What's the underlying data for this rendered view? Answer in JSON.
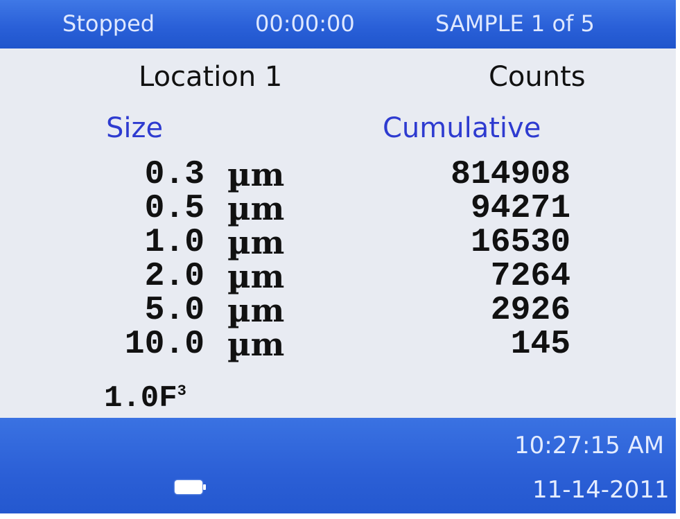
{
  "status_bar": {
    "status": "Stopped",
    "timer": "00:00:00",
    "sample": "SAMPLE 1 of 5"
  },
  "header": {
    "location": "Location 1",
    "counts": "Counts"
  },
  "columns": {
    "size": "Size",
    "cumulative": "Cumulative"
  },
  "rows": [
    {
      "size": "0.3",
      "unit": "µm",
      "count": "814908"
    },
    {
      "size": "0.5",
      "unit": "µm",
      "count": "94271"
    },
    {
      "size": "1.0",
      "unit": "µm",
      "count": "16530"
    },
    {
      "size": "2.0",
      "unit": "µm",
      "count": "7264"
    },
    {
      "size": "5.0",
      "unit": "µm",
      "count": "2926"
    },
    {
      "size": "10.0",
      "unit": "µm",
      "count": "145"
    }
  ],
  "volume": {
    "value": "1.0F",
    "exponent": "3"
  },
  "footer": {
    "time": "10:27:15 AM",
    "date": "11-14-2011",
    "battery_icon": "battery-icon"
  },
  "colors": {
    "bar_blue": "#2a60d8",
    "label_blue": "#2e3bd0",
    "background": "#e8ebf2"
  }
}
